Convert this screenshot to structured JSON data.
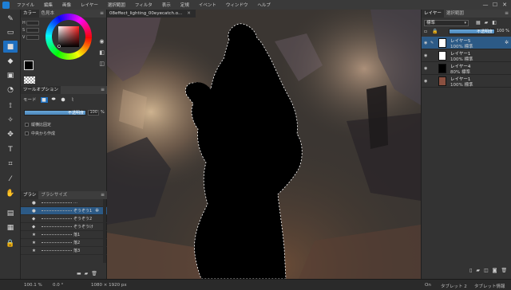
{
  "menu": {
    "items": [
      "ファイル",
      "編集",
      "画像",
      "レイヤー",
      "選択範囲",
      "フィルタ",
      "表示",
      "定規",
      "イベント",
      "ウィンドウ",
      "ヘルプ"
    ],
    "window_controls": [
      "—",
      "☐",
      "✕"
    ]
  },
  "toolbar": {
    "tools": [
      "brush-icon",
      "eraser-icon",
      "rectangle-select-icon",
      "fill-icon",
      "gradient-icon",
      "smudge-icon",
      "lasso-icon",
      "magic-wand-icon",
      "move-icon",
      "text-icon",
      "crop-icon",
      "eyedropper-icon",
      "hand-icon",
      "ruler-icon",
      "frame-icon",
      "lock-icon"
    ],
    "active_index": 2
  },
  "color_panel": {
    "tabs": [
      "カラー",
      "色見本"
    ],
    "hsv_labels": [
      "H",
      "S",
      "V"
    ],
    "hsv_values": [
      "0",
      "0",
      "0"
    ],
    "foreground": "#000000",
    "background": "#ffffff"
  },
  "tool_options": {
    "title": "ツールオプション",
    "mode_label": "モード",
    "opacity_label": "不透明度",
    "opacity_value": "100",
    "opacity_unit": "%",
    "checkbox_1": "縦横比固定",
    "checkbox_2": "中央から作成"
  },
  "brush_panel": {
    "tabs": [
      "ブラシ",
      "ブラシサイズ"
    ],
    "brushes": [
      {
        "name": "…",
        "selected": false
      },
      {
        "name": "ぞうぞう1",
        "selected": true
      },
      {
        "name": "ぞうぞう2",
        "selected": false
      },
      {
        "name": "ぞうぞうけ",
        "selected": false
      },
      {
        "name": "落1",
        "selected": false
      },
      {
        "name": "落2",
        "selected": false
      },
      {
        "name": "落3",
        "selected": false
      }
    ]
  },
  "document": {
    "tab_title": "08effect_lighting_00eyecatch.o...",
    "close": "✕"
  },
  "layers_panel": {
    "tabs": [
      "レイヤー",
      "選択範囲"
    ],
    "blend_mode": "標準",
    "opacity_label": "不透明度",
    "opacity_value": "100",
    "opacity_unit": "%",
    "layers": [
      {
        "name": "レイヤー5",
        "mode": "100% 標準",
        "selected": true,
        "thumb": "#ffffff"
      },
      {
        "name": "レイヤー1",
        "mode": "100% 標準",
        "selected": false,
        "thumb": "#ffffff"
      },
      {
        "name": "レイヤー4",
        "mode": "80% 標準",
        "selected": false,
        "thumb": "#000000"
      },
      {
        "name": "レイヤー1",
        "mode": "100% 標準",
        "selected": false,
        "thumb": "#8a5040"
      }
    ]
  },
  "status": {
    "zoom": "100.1 %",
    "angle": "0.0 °",
    "size": "1080 × 1920 px",
    "on": "On",
    "tablet": "タブレット 2",
    "tablet_info": "タブレット情報"
  },
  "colors": {
    "accent": "#1e6fbf",
    "selected_row": "#2c5a86"
  }
}
